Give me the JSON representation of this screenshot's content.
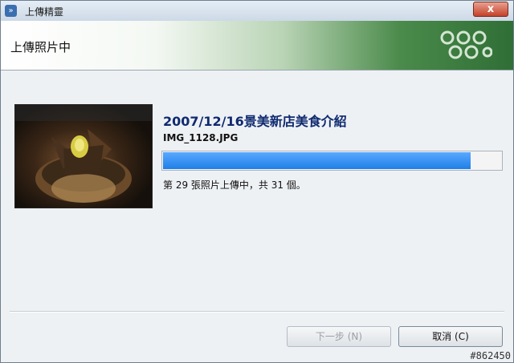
{
  "window": {
    "title": "上傳精靈",
    "app_icon": "wizard-icon",
    "close_label": "x"
  },
  "header": {
    "title": "上傳照片中"
  },
  "upload": {
    "album_title": "2007/12/16景美新店美食介紹",
    "file_name": "IMG_1128.JPG",
    "status_text": "第 29 張照片上傳中，共 31 個。",
    "progress_fraction": 0.91
  },
  "buttons": {
    "next_label": "下一步 (N)",
    "cancel_label": "取消 (C)"
  },
  "watermark": "#862450",
  "colors": {
    "accent_blue": "#1e7fe8",
    "header_green": "#2f6f36",
    "album_title": "#0f2a70"
  }
}
